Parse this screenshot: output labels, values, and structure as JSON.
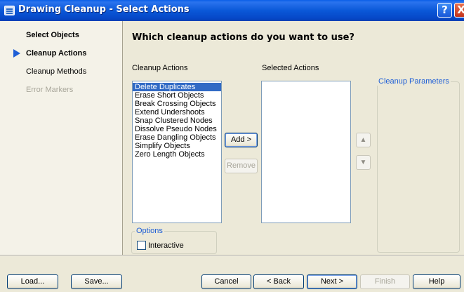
{
  "window": {
    "title": "Drawing Cleanup - Select Actions"
  },
  "title_buttons": {
    "help": "?",
    "close": "X"
  },
  "steps": [
    {
      "label": "Select Objects",
      "state": "done"
    },
    {
      "label": "Cleanup Actions",
      "state": "current"
    },
    {
      "label": "Cleanup Methods",
      "state": "pending"
    },
    {
      "label": "Error Markers",
      "state": "disabled"
    }
  ],
  "main": {
    "heading": "Which cleanup actions do you want to use?",
    "cleanup_actions_label": "Cleanup Actions",
    "selected_actions_label": "Selected Actions",
    "cleanup_params_label": "Cleanup Parameters",
    "cleanup_actions": [
      "Delete Duplicates",
      "Erase Short Objects",
      "Break Crossing Objects",
      "Extend Undershoots",
      "Snap Clustered Nodes",
      "Dissolve Pseudo Nodes",
      "Erase Dangling Objects",
      "Simplify Objects",
      "Zero Length Objects"
    ],
    "selected_index": 0,
    "selected_actions": [],
    "add_button": "Add >",
    "remove_button": "Remove",
    "options_label": "Options",
    "interactive_label": "Interactive",
    "interactive_checked": false
  },
  "icons": {
    "move_up": "move-up-icon",
    "move_down": "move-down-icon",
    "app": "app-icon"
  },
  "footer": {
    "load": "Load...",
    "save": "Save...",
    "cancel": "Cancel",
    "back": "< Back",
    "next": "Next >",
    "finish": "Finish",
    "help": "Help"
  },
  "colors": {
    "accent": "#1f5fd6",
    "selection": "#316ac5",
    "titlebar": "#0a58d8"
  }
}
